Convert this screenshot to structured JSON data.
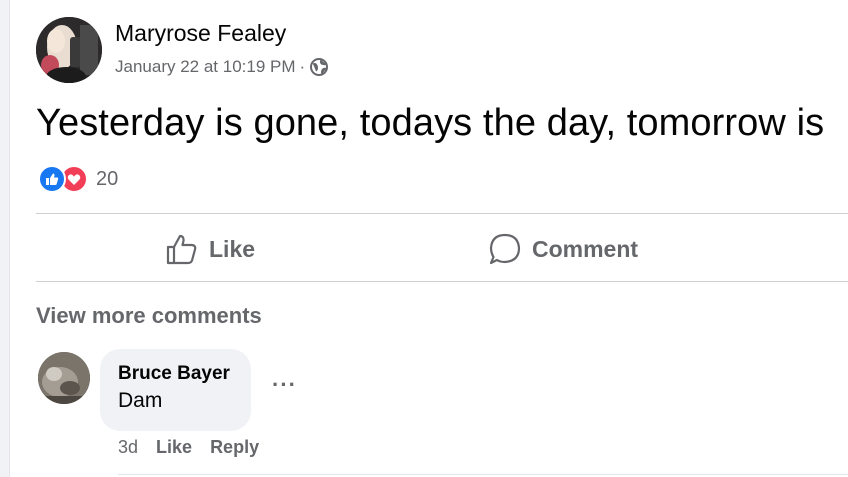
{
  "post": {
    "author": "Maryrose Fealey",
    "timestamp": "January 22 at 10:19 PM",
    "separator": "·",
    "audience_icon": "globe-icon",
    "text": "Yesterday is gone, todays the day, tomorrow is",
    "reactions": {
      "types": [
        "like",
        "love"
      ],
      "count": "20"
    }
  },
  "actions": {
    "like_label": "Like",
    "comment_label": "Comment"
  },
  "comments": {
    "view_more_label": "View more comments",
    "items": [
      {
        "author": "Bruce Bayer",
        "text": "Dam",
        "age": "3d",
        "like_label": "Like",
        "reply_label": "Reply",
        "more_label": "···"
      }
    ]
  },
  "colors": {
    "like_blue": "#1877f2",
    "love_red": "#f33e58",
    "secondary_text": "#65676b",
    "primary_text": "#050505",
    "bubble_bg": "#f0f2f5"
  }
}
